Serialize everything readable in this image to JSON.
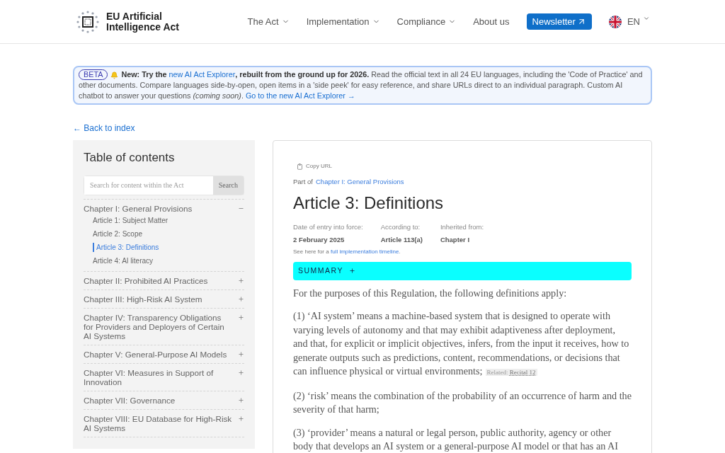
{
  "header": {
    "logo_text": "EU Artificial Intelligence Act",
    "nav": [
      {
        "label": "The Act",
        "has_menu": true
      },
      {
        "label": "Implementation",
        "has_menu": true
      },
      {
        "label": "Compliance",
        "has_menu": true
      },
      {
        "label": "About us",
        "has_menu": false
      }
    ],
    "newsletter": "Newsletter",
    "language": "EN"
  },
  "banner": {
    "badge": "BETA",
    "segments": [
      {
        "kind": "bold",
        "text": "New: Try the "
      },
      {
        "kind": "link",
        "text": "new AI Act Explorer"
      },
      {
        "kind": "bold",
        "text": ", rebuilt from the ground up for 2026."
      },
      {
        "kind": "plain",
        "text": " Read the official text in all 24 EU languages, including the 'Code of Practice' and other documents. Compare languages side-by-open, open items in a 'side peek' for easy reference, and share URLs direct to an individual paragraph. Custom AI chatbot to answer your questions "
      },
      {
        "kind": "italic",
        "text": "(coming soon)"
      },
      {
        "kind": "plain",
        "text": ". "
      },
      {
        "kind": "link",
        "text": "Go to the new AI Act Explorer →"
      }
    ]
  },
  "back_link": "← Back to index",
  "toc": {
    "title": "Table of contents",
    "search": {
      "placeholder": "Search for content within the Act",
      "button": "Search"
    },
    "chapters": [
      {
        "title": "Chapter I: General Provisions",
        "expanded": true,
        "children": [
          {
            "title": "Article 1: Subject Matter",
            "selected": false
          },
          {
            "title": "Article 2: Scope",
            "selected": false
          },
          {
            "title": "Article 3: Definitions",
            "selected": true
          },
          {
            "title": "Article 4: AI literacy",
            "selected": false
          }
        ]
      },
      {
        "title": "Chapter II: Prohibited AI Practices",
        "expanded": false
      },
      {
        "title": "Chapter III: High-Risk AI System",
        "expanded": false
      },
      {
        "title": "Chapter IV: Transparency Obligations for Providers and Deployers of Certain AI Systems",
        "expanded": false
      },
      {
        "title": "Chapter V: General-Purpose AI Models",
        "expanded": false
      },
      {
        "title": "Chapter VI: Measures in Support of Innovation",
        "expanded": false
      },
      {
        "title": "Chapter VII: Governance",
        "expanded": false
      },
      {
        "title": "Chapter VIII: EU Database for High-Risk AI Systems",
        "expanded": false
      }
    ]
  },
  "article": {
    "copy_url": "Copy URL",
    "part_of_label": "Part of",
    "part_of_link": "Chapter I: General Provisions",
    "title": "Article 3: Definitions",
    "meta": [
      {
        "label": "Date of entry into force:",
        "value": "2 February 2025"
      },
      {
        "label": "According to:",
        "value": "Article 113(a)"
      },
      {
        "label": "Inherited from:",
        "value": "Chapter I"
      }
    ],
    "timeline_prefix": "See here for a",
    "timeline_link": "full implementation timeline",
    "timeline_suffix": ".",
    "summary": "SUMMARY",
    "summary_expanded": false,
    "paragraphs": [
      {
        "text": "For the purposes of this Regulation, the following definitions apply:"
      },
      {
        "text": "(1) ‘AI system’ means a machine-based system that is designed to operate with varying levels of autonomy and that may exhibit adaptiveness after deployment, and that, for explicit or implicit objectives, infers, from the input it receives, how to generate outputs such as predictions, content, recommendations, or decisions that can influence physical or virtual environments;",
        "related_label": "Related:",
        "related_link": "Recital 12"
      },
      {
        "text": "(2) ‘risk’ means the combination of the probability of an occurrence of harm and the severity of that harm;"
      },
      {
        "text": "(3) ‘provider’ means a natural or legal person, public authority, agency or other body that develops an AI system or a general-purpose AI model or that has an AI"
      }
    ]
  }
}
